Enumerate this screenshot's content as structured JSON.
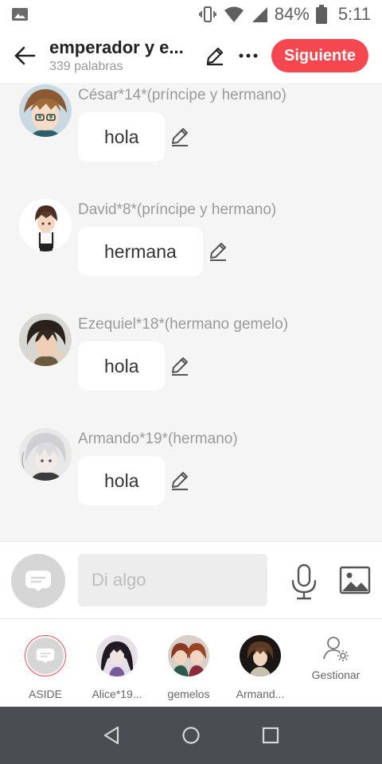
{
  "status_bar": {
    "battery": "84%",
    "time": "5:11",
    "icons": [
      "image-notification-icon",
      "vibrate-icon",
      "wifi-icon",
      "signal-icon",
      "battery-icon"
    ]
  },
  "header": {
    "title": "emperador y e...",
    "subtitle": "339 palabras",
    "next_label": "Siguiente",
    "accent_color": "#f5474f"
  },
  "messages": [
    {
      "name": "César*14*(príncipe y hermano)",
      "text": "hola"
    },
    {
      "name": "David*8*(príncipe y hermano)",
      "text": "hermana"
    },
    {
      "name": "Ezequiel*18*(hermano gemelo)",
      "text": "hola"
    },
    {
      "name": "Armando*19*(hermano)",
      "text": "hola"
    }
  ],
  "input": {
    "placeholder": "Di algo",
    "value": ""
  },
  "characters": [
    {
      "label": "ASIDE",
      "selected": true
    },
    {
      "label": "Alice*19..."
    },
    {
      "label": "gemelos"
    },
    {
      "label": "Armand..."
    },
    {
      "label": "Gestionar"
    }
  ]
}
